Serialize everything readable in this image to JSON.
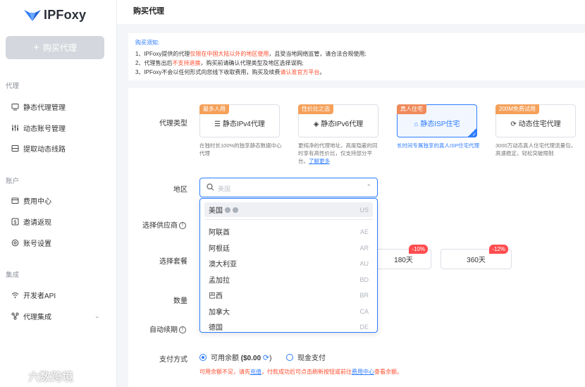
{
  "app": {
    "name": "IPFoxy"
  },
  "sidebar": {
    "buy_button": "购买代理",
    "sections": [
      {
        "title": "代理",
        "items": [
          {
            "label": "静态代理管理"
          },
          {
            "label": "动态账号管理"
          },
          {
            "label": "提取动态线路"
          }
        ]
      },
      {
        "title": "账户",
        "items": [
          {
            "label": "费用中心"
          },
          {
            "label": "邀请返现"
          },
          {
            "label": "账号设置"
          }
        ]
      },
      {
        "title": "集成",
        "items": [
          {
            "label": "开发者API"
          },
          {
            "label": "代理集成"
          }
        ]
      }
    ]
  },
  "header": {
    "title": "购买代理"
  },
  "notice": {
    "title": "购买须知:",
    "line1_a": "1、IPFoxy提供的代理",
    "line1_red": "仅限在中国大陆以外的地区使用",
    "line1_b": "，且受当地网络监管，请合法合规使用;",
    "line2_a": "2、代理售出后",
    "line2_red": "不支持退换",
    "line2_b": "，购买前请确认代理类型及地区选择误购;",
    "line3_a": "3、IPFoxy不会以任何形式向您线下收取费用，购买及续费",
    "line3_red": "请认准官方平台",
    "line3_b": "。"
  },
  "form": {
    "proxy_type_label": "代理类型",
    "region_label": "地区",
    "supplier_label": "选择供应商",
    "package_label": "选择套餐",
    "quantity_label": "数量",
    "auto_renew_label": "自动续期",
    "payment_label": "支付方式",
    "proxy_types": [
      {
        "tag": "最多人用",
        "label": "静态IPv4代理",
        "desc": "在独时长100%的独享静态数据中心代理",
        "selected": false
      },
      {
        "tag": "性价比之选",
        "label": "静态IPv6代理",
        "desc": "更纯净的代理地址，高度隐蔽的同时享有高性价比，仅支持部分平台。",
        "link": "了解更多",
        "selected": false
      },
      {
        "tag": "真人住宅",
        "label": "静态ISP住宅",
        "desc": "长时间专属独享的真人ISP住宅代理",
        "selected": true
      },
      {
        "tag": "200M免费试用",
        "label": "动态住宅代理",
        "desc": "3000万动态真人住宅代理流量包，高速稳定，轻松突破限制",
        "selected": false
      }
    ],
    "region": {
      "placeholder": "美国",
      "options": [
        {
          "name": "美国",
          "code": "US"
        },
        {
          "name": "阿联酋",
          "code": "AE"
        },
        {
          "name": "阿根廷",
          "code": "AR"
        },
        {
          "name": "澳大利亚",
          "code": "AU"
        },
        {
          "name": "孟加拉",
          "code": "BD"
        },
        {
          "name": "巴西",
          "code": "BR"
        },
        {
          "name": "加拿大",
          "code": "CA"
        },
        {
          "name": "德国",
          "code": "DE"
        }
      ]
    },
    "packages": [
      {
        "label": "180天",
        "discount": "-10%"
      },
      {
        "label": "360天",
        "discount": "-12%"
      }
    ],
    "payment": {
      "option1_a": "可用余额",
      "option1_b": "($0.00",
      "option1_c": ")",
      "option2": "现金支付",
      "note_a": "可用余额不足，请先",
      "note_link1": "充值",
      "note_b": "，付款成功后可点击刷新按钮或前往",
      "note_link2": "费用中心",
      "note_c": "查看余额。"
    }
  },
  "watermark": "六数跨境",
  "colors": {
    "accent": "#2f7dff",
    "warning": "#ff4d2e",
    "tag": "#f5a05a"
  }
}
